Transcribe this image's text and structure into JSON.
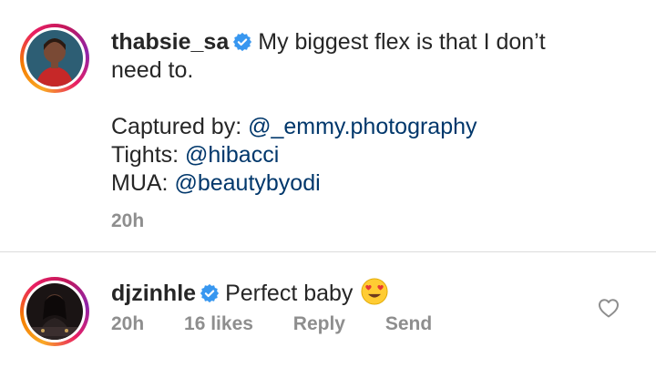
{
  "caption": {
    "username": "thabsie_sa",
    "text_line1": "My biggest flex is that I don’t",
    "text_line2": "need to.",
    "captured_label": "Captured by: ",
    "captured_handle": "@_emmy.photography",
    "tights_label": "Tights: ",
    "tights_handle": "@hibacci",
    "mua_label": "MUA: ",
    "mua_handle": "@beautybyodi",
    "time": "20h"
  },
  "comment": {
    "username": "djzinhle",
    "text": "Perfect baby",
    "emoji": "heart-eyes-emoji",
    "time": "20h",
    "likes": "16 likes",
    "reply_label": "Reply",
    "send_label": "Send"
  },
  "colors": {
    "link": "#00376b",
    "secondary": "#8e8e8e",
    "verified": "#3897f0"
  }
}
